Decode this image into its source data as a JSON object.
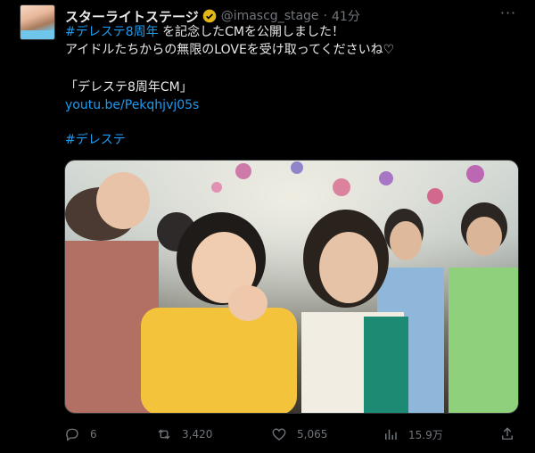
{
  "tweet": {
    "author_name": "スターライトステージ",
    "handle": "@imascg_stage",
    "separator": "·",
    "time": "41分",
    "line1_hashtag": "#デレステ8周年",
    "line1_rest": " を記念したCMを公開しました！",
    "line2": "アイドルたちからの無限のLOVEを受け取ってくださいね♡",
    "line3": "「デレステ8周年CM」",
    "link": "youtu.be/Pekqhjvj05s",
    "hashtag_footer": "#デレステ"
  },
  "actions": {
    "replies": "6",
    "retweets": "3,420",
    "likes": "5,065",
    "views": "15.9万"
  },
  "colors": {
    "link": "#1d9bf0",
    "muted": "#71767b",
    "verified": "#e2b719"
  },
  "icons": [
    "verified-badge-icon",
    "more-icon",
    "reply-icon",
    "retweet-icon",
    "like-icon",
    "views-icon",
    "share-icon"
  ]
}
